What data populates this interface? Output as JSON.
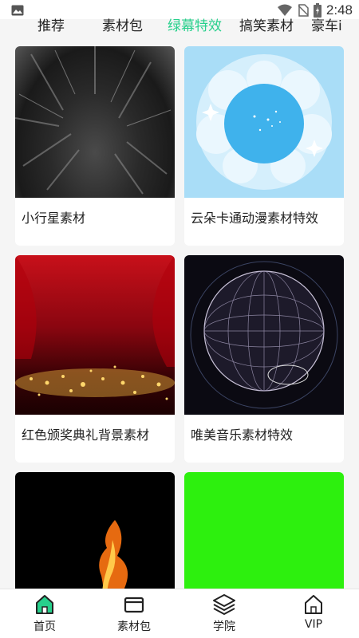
{
  "status_bar": {
    "time": "2:48"
  },
  "tabs": [
    {
      "label": "推荐",
      "active": false
    },
    {
      "label": "素材包",
      "active": false
    },
    {
      "label": "绿幕特效",
      "active": true
    },
    {
      "label": "搞笑素材",
      "active": false
    },
    {
      "label": "豪车i",
      "active": false
    }
  ],
  "cards": [
    {
      "title": ""
    },
    {
      "title": ""
    },
    {
      "title": "小行星素材"
    },
    {
      "title": "云朵卡通动漫素材特效"
    },
    {
      "title": "红色颁奖典礼背景素材"
    },
    {
      "title": "唯美音乐素材特效"
    },
    {
      "title": ""
    },
    {
      "title": ""
    }
  ],
  "nav": [
    {
      "label": "首页",
      "icon": "home-icon",
      "active": true
    },
    {
      "label": "素材包",
      "icon": "card-icon",
      "active": false
    },
    {
      "label": "学院",
      "icon": "layers-icon",
      "active": false
    },
    {
      "label": "VIP",
      "icon": "home-outline-icon",
      "active": false
    }
  ],
  "colors": {
    "accent": "#27d08c",
    "green_screen": "#2df00e"
  }
}
